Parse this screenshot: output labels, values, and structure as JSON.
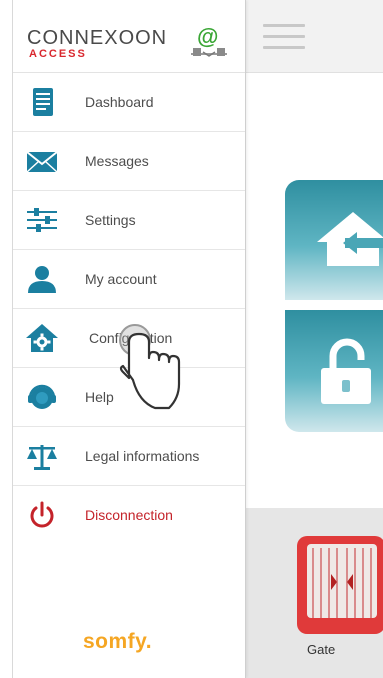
{
  "brand": {
    "name": "CONNEXOON",
    "subtitle": "ACCESS",
    "logo_icon": "at-connection-icon"
  },
  "menu": [
    {
      "label": "Dashboard",
      "icon": "dashboard-icon"
    },
    {
      "label": "Messages",
      "icon": "envelope-icon"
    },
    {
      "label": "Settings",
      "icon": "sliders-icon"
    },
    {
      "label": "My account",
      "icon": "user-icon"
    },
    {
      "label": "Configuration",
      "icon": "house-gear-icon"
    },
    {
      "label": "Help",
      "icon": "headset-icon"
    },
    {
      "label": "Legal informations",
      "icon": "scales-icon"
    },
    {
      "label": "Disconnection",
      "icon": "power-icon"
    }
  ],
  "footer": {
    "logo_text": "somfy."
  },
  "main": {
    "tiles": [
      {
        "icon": "house-arrow-icon"
      },
      {
        "icon": "open-lock-icon"
      }
    ],
    "devices": [
      {
        "label": "Gate",
        "icon": "gate-icon"
      }
    ]
  },
  "colors": {
    "teal_tile": "#2f8fa0",
    "icon_blue": "#1b7fa0",
    "disconnect_red": "#c4232a",
    "brand_red": "#d9272e",
    "somfy_orange": "#f5a623",
    "gate_red": "#e03a3a"
  }
}
